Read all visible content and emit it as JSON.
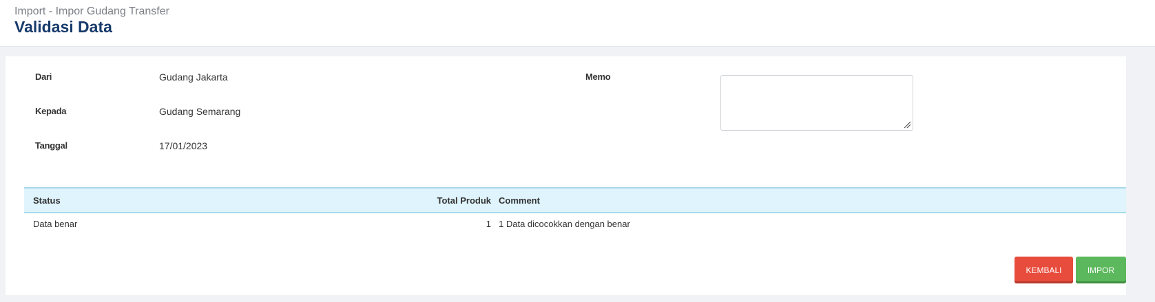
{
  "header": {
    "breadcrumb": "Import - Impor Gudang Transfer",
    "title": "Validasi Data"
  },
  "form": {
    "from": {
      "label": "Dari",
      "value": "Gudang Jakarta"
    },
    "to": {
      "label": "Kepada",
      "value": "Gudang Semarang"
    },
    "date": {
      "label": "Tanggal",
      "value": "17/01/2023"
    },
    "memo": {
      "label": "Memo",
      "value": ""
    }
  },
  "table": {
    "columns": [
      "Status",
      "Total Produk",
      "Comment"
    ],
    "rows": [
      {
        "status": "Data benar",
        "total": "1",
        "comment": "1 Data dicocokkan dengan benar"
      }
    ]
  },
  "actions": {
    "back_label": "KEMBALI",
    "import_label": "IMPOR"
  },
  "colors": {
    "title": "#173a6b",
    "header_row": "#dff4fc",
    "back_button": "#e74c3c",
    "import_button": "#5cb85c"
  }
}
